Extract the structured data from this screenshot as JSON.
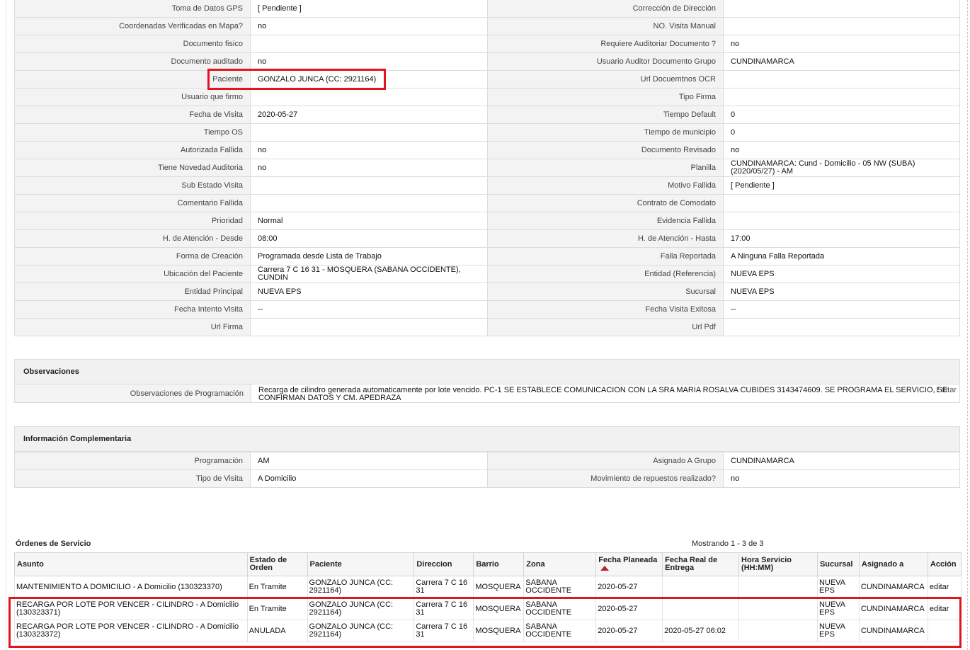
{
  "details": [
    {
      "l1": "Toma de Datos GPS",
      "v1": "[ Pendiente ]",
      "l2": "Corrección de Dirección",
      "v2": ""
    },
    {
      "l1": "Coordenadas Verificadas en Mapa?",
      "v1": "no",
      "l2": "NO. Visita Manual",
      "v2": ""
    },
    {
      "l1": "Documento fisico",
      "v1": "",
      "l2": "Requiere Auditoriar Documento ?",
      "v2": "no"
    },
    {
      "l1": "Documento auditado",
      "v1": "no",
      "l2": "Usuario Auditor Documento Grupo",
      "v2": "CUNDINAMARCA"
    },
    {
      "l1": "Paciente",
      "v1": "GONZALO JUNCA (CC: 2921164)",
      "l2": "Url Docuemtnos OCR",
      "v2": ""
    },
    {
      "l1": "Usuario que firmo",
      "v1": "",
      "l2": "Tipo Firma",
      "v2": ""
    },
    {
      "l1": "Fecha de Visita",
      "v1": "2020-05-27",
      "l2": "Tiempo Default",
      "v2": "0"
    },
    {
      "l1": "Tiempo OS",
      "v1": "",
      "l2": "Tiempo de municipio",
      "v2": "0"
    },
    {
      "l1": "Autorizada Fallida",
      "v1": "no",
      "l2": "Documento Revisado",
      "v2": "no"
    },
    {
      "l1": "Tiene Novedad Auditoria",
      "v1": "no",
      "l2": "Planilla",
      "v2": "CUNDINAMARCA: Cund - Domicilio - 05 NW (SUBA) (2020/05/27) - AM"
    },
    {
      "l1": "Sub Estado Visita",
      "v1": "",
      "l2": "Motivo Fallida",
      "v2": "[ Pendiente ]"
    },
    {
      "l1": "Comentario Fallida",
      "v1": "",
      "l2": "Contrato de Comodato",
      "v2": ""
    },
    {
      "l1": "Prioridad",
      "v1": "Normal",
      "l2": "Evidencia Fallida",
      "v2": ""
    },
    {
      "l1": "H. de Atención - Desde",
      "v1": "08:00",
      "l2": "H. de Atención - Hasta",
      "v2": "17:00"
    },
    {
      "l1": "Forma de Creación",
      "v1": "Programada desde Lista de Trabajo",
      "l2": "Falla Reportada",
      "v2": "A Ninguna Falla Reportada"
    },
    {
      "l1": "Ubicación del Paciente",
      "v1": "Carrera 7 C 16 31 - MOSQUERA (SABANA OCCIDENTE), CUNDIN",
      "l2": "Entidad (Referencia)",
      "v2": "NUEVA EPS"
    },
    {
      "l1": "Entidad Principal",
      "v1": "NUEVA EPS",
      "l2": "Sucursal",
      "v2": "NUEVA EPS"
    },
    {
      "l1": "Fecha Intento Visita",
      "v1": "--",
      "l2": "Fecha Visita Exitosa",
      "v2": "--"
    },
    {
      "l1": "Url Firma",
      "v1": "",
      "l2": "Url Pdf",
      "v2": ""
    }
  ],
  "observaciones": {
    "title": "Observaciones",
    "label": "Observaciones de Programación",
    "value": "Recarga de cilindro generada automaticamente por lote vencido. PC-1 SE ESTABLECE COMUNICACION CON LA SRA MARIA ROSALVA CUBIDES 3143474609. SE PROGRAMA EL SERVICIO, SE CONFIRMAN DATOS Y CM. APEDRAZA",
    "edit": "Editar"
  },
  "complementaria": {
    "title": "Información Complementaria",
    "rows": [
      {
        "l1": "Programación",
        "v1": "AM",
        "l2": "Asignado A Grupo",
        "v2": "CUNDINAMARCA"
      },
      {
        "l1": "Tipo de Visita",
        "v1": "A Domicilio",
        "l2": "Movimiento de repuestos realizado?",
        "v2": "no"
      }
    ]
  },
  "orders": {
    "title": "Órdenes de Servicio",
    "count": "Mostrando 1 - 3 de 3",
    "headers": [
      "Asunto",
      "Estado de Orden",
      "Paciente",
      "Direccion",
      "Barrio",
      "Zona",
      "Fecha Planeada",
      "Fecha Real de Entrega",
      "Hora Servicio (HH:MM)",
      "Sucursal",
      "Asignado a",
      "Acción"
    ],
    "rows": [
      [
        "MANTENIMIENTO A DOMICILIO - A Domicilio (130323370)",
        "En Tramite",
        "GONZALO JUNCA (CC: 2921164)",
        "Carrera 7 C 16 31",
        "MOSQUERA",
        "SABANA OCCIDENTE",
        "2020-05-27",
        "",
        "",
        "NUEVA EPS",
        "CUNDINAMARCA",
        "editar"
      ],
      [
        "RECARGA POR LOTE POR VENCER - CILINDRO - A Domicilio (130323371)",
        "En Tramite",
        "GONZALO JUNCA (CC: 2921164)",
        "Carrera 7 C 16 31",
        "MOSQUERA",
        "SABANA OCCIDENTE",
        "2020-05-27",
        "",
        "",
        "NUEVA EPS",
        "CUNDINAMARCA",
        "editar"
      ],
      [
        "RECARGA POR LOTE POR VENCER - CILINDRO - A Domicilio (130323372)",
        "ANULADA",
        "GONZALO JUNCA (CC: 2921164)",
        "Carrera 7 C 16 31",
        "MOSQUERA",
        "SABANA OCCIDENTE",
        "2020-05-27",
        "2020-05-27 06:02",
        "",
        "NUEVA EPS",
        "CUNDINAMARCA",
        ""
      ]
    ]
  },
  "highlight_color": "#e0151f"
}
